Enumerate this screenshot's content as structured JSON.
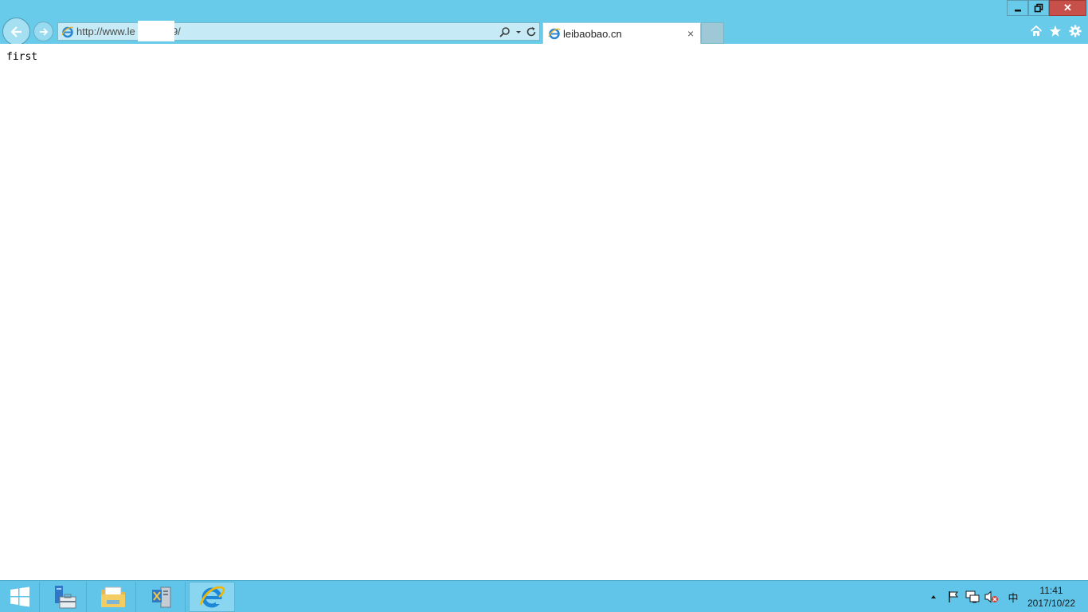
{
  "browser": {
    "address_url": "http://www.le        .cn:8089/",
    "tab_title": "leibaobao.cn",
    "tab_close": "×",
    "window_controls": {
      "minimize_icon": "minimize-icon",
      "restore_icon": "restore-icon",
      "close_label": "✕"
    },
    "command_icons": [
      "home-icon",
      "star-icon",
      "gear-icon"
    ]
  },
  "page": {
    "body_text": "first"
  },
  "taskbar": {
    "items": [
      "start-icon",
      "server-manager-icon",
      "file-explorer-icon",
      "tools-icon",
      "internet-explorer-icon"
    ],
    "tray": [
      "show-hidden-icons-arrow",
      "action-center-flag-icon",
      "network-icon",
      "volume-muted-icon",
      "ime-icon"
    ],
    "ime_label": "中",
    "clock_time": "11:41",
    "clock_date": "2017/10/22"
  },
  "colors": {
    "chrome": "#67cbe9",
    "close_red": "#c7504a",
    "taskbar": "#60c5e8"
  }
}
